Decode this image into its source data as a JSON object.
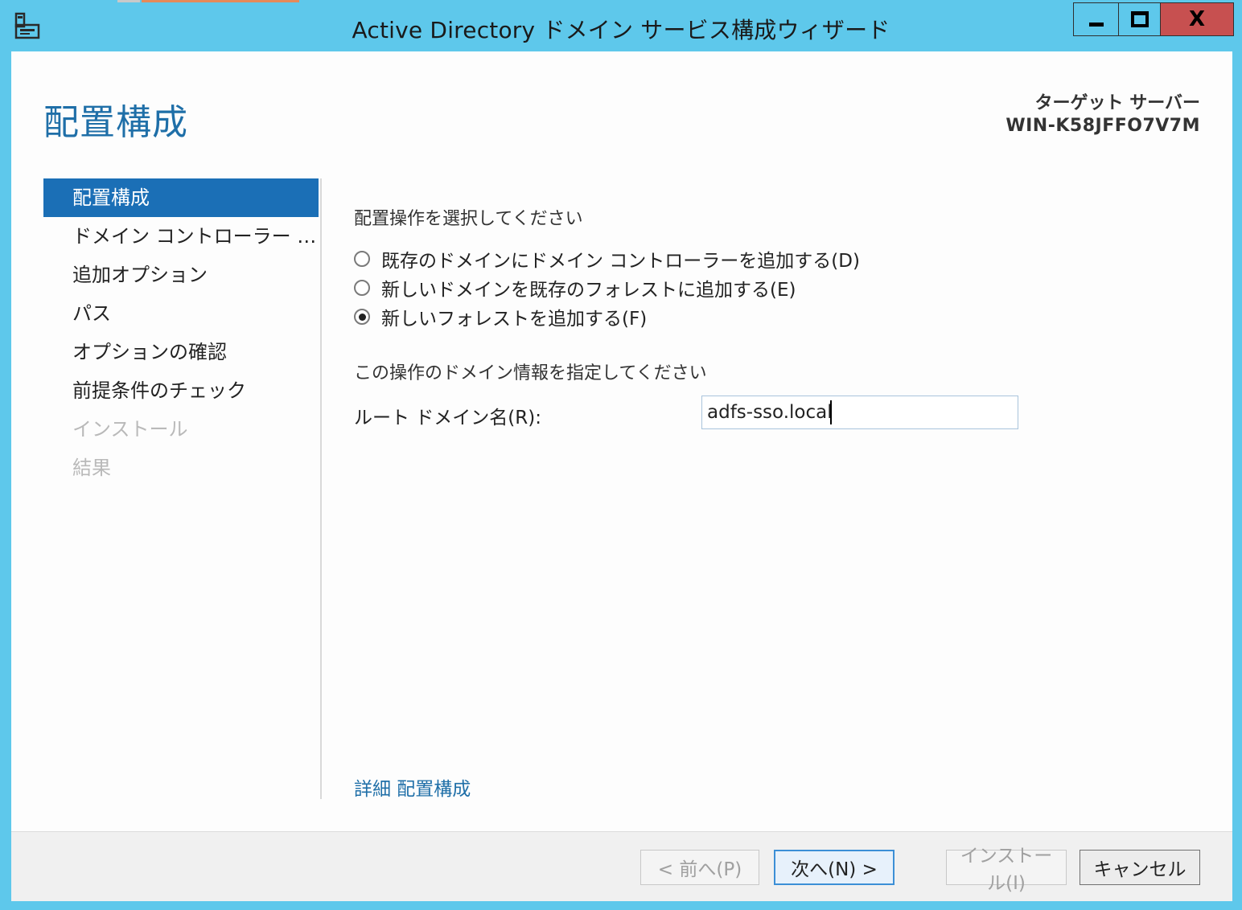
{
  "window": {
    "title": "Active Directory ドメイン サービス構成ウィザード",
    "minimize_icon": "minimize-icon",
    "maximize_icon": "maximize-icon",
    "close_label": "X",
    "close_color": "#c75050",
    "title_bar_color": "#5ec8eb"
  },
  "header": {
    "page_title": "配置構成",
    "target_caption": "ターゲット サーバー",
    "target_name": "WIN-K58JFFO7V7M"
  },
  "nav": {
    "items": [
      {
        "label": "配置構成",
        "state": "active"
      },
      {
        "label": "ドメイン コントローラー オプ…",
        "state": "normal"
      },
      {
        "label": "追加オプション",
        "state": "normal"
      },
      {
        "label": "パス",
        "state": "normal"
      },
      {
        "label": "オプションの確認",
        "state": "normal"
      },
      {
        "label": "前提条件のチェック",
        "state": "normal"
      },
      {
        "label": "インストール",
        "state": "disabled"
      },
      {
        "label": "結果",
        "state": "disabled"
      }
    ],
    "active_color": "#1b6fb6"
  },
  "main": {
    "select_operation_label": "配置操作を選択してください",
    "options": [
      {
        "label": "既存のドメインにドメイン コントローラーを追加する(D)",
        "selected": false
      },
      {
        "label": "新しいドメインを既存のフォレストに追加する(E)",
        "selected": false
      },
      {
        "label": "新しいフォレストを追加する(F)",
        "selected": true
      }
    ],
    "domain_info_label": "この操作のドメイン情報を指定してください",
    "root_domain_label": "ルート ドメイン名(R):",
    "root_domain_value": "adfs-sso.local",
    "more_link": "詳細 配置構成"
  },
  "footer": {
    "prev_label": "< 前へ(P)",
    "next_label": "次へ(N) >",
    "install_label": "インストール(I)",
    "cancel_label": "キャンセル"
  }
}
